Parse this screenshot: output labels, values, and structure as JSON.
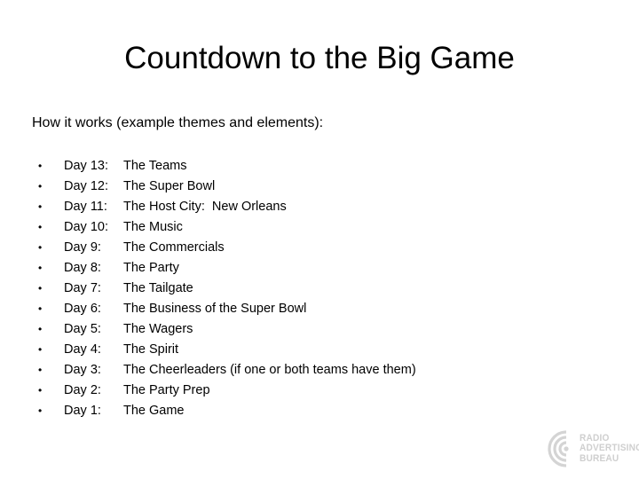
{
  "slide": {
    "title": "Countdown to the Big Game",
    "intro": "How it works (example themes and elements):",
    "background_color": "#ffffff",
    "text_color": "#000000",
    "bullet_glyph": "•",
    "items": [
      {
        "day": "Day 13:",
        "topic": "The Teams"
      },
      {
        "day": "Day 12:",
        "topic": "The Super Bowl"
      },
      {
        "day": "Day 11:",
        "topic": "The Host City:  New Orleans"
      },
      {
        "day": "Day 10:",
        "topic": "The Music"
      },
      {
        "day": "Day 9:",
        "topic": "The Commercials"
      },
      {
        "day": "Day 8:",
        "topic": "The Party"
      },
      {
        "day": "Day 7:",
        "topic": "The Tailgate"
      },
      {
        "day": "Day 6:",
        "topic": "The Business of the Super Bowl"
      },
      {
        "day": "Day 5:",
        "topic": "The Wagers"
      },
      {
        "day": "Day 4:",
        "topic": "The Spirit"
      },
      {
        "day": "Day 3:",
        "topic": "The Cheerleaders (if one or both teams have them)"
      },
      {
        "day": "Day 2:",
        "topic": "The Party Prep"
      },
      {
        "day": "Day 1:",
        "topic": "The Game"
      }
    ]
  },
  "logo": {
    "line1": "RADIO",
    "line2": "ADVERTISING",
    "line3": "BUREAU",
    "color": "#cfcfcf",
    "mark": "radio-waves-icon"
  }
}
